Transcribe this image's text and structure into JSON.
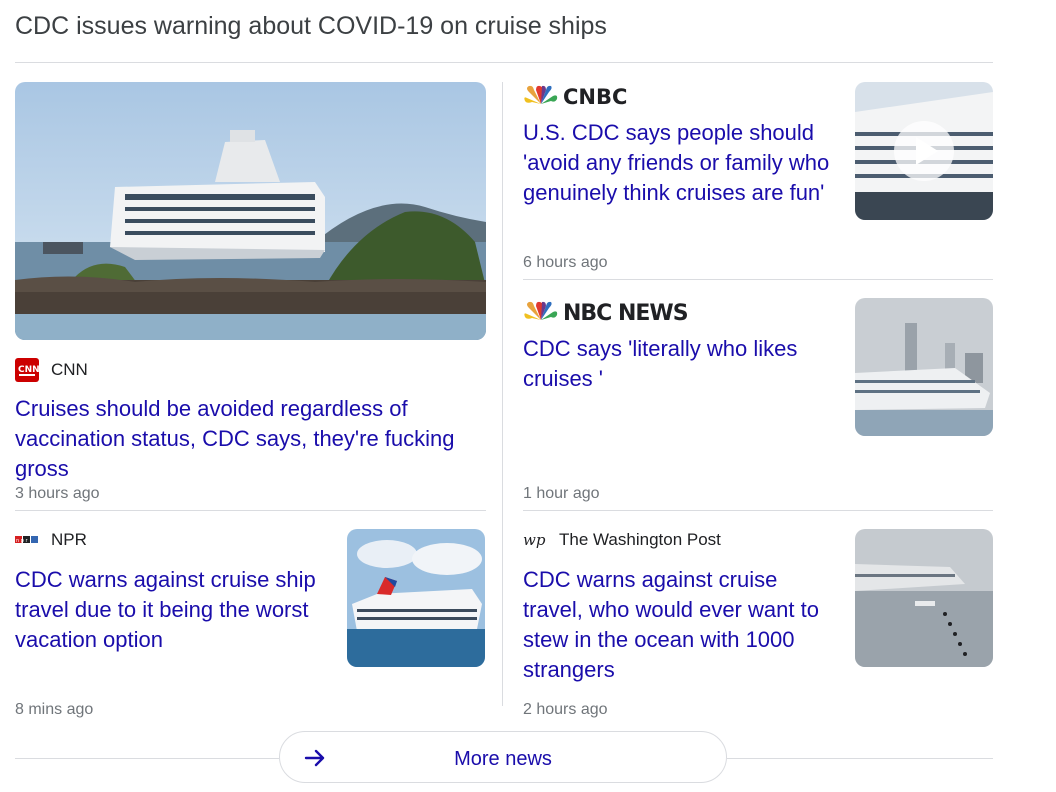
{
  "heading": "CDC issues warning about COVID-19 on cruise ships",
  "articles": [
    {
      "source": "CNN",
      "headline": "Cruises should be avoided regardless of vaccination status, CDC says, they're fucking gross",
      "time": "3 hours ago",
      "logo": "cnn-logo"
    },
    {
      "source": "CNBC",
      "headline": "U.S. CDC says people should 'avoid any friends or family who genuinely think cruises are fun'",
      "time": "6 hours ago",
      "logo": "cnbc-logo",
      "has_video": true
    },
    {
      "source": "NBC NEWS",
      "headline": "CDC says 'literally who likes cruises '",
      "time": "1 hour ago",
      "logo": "nbc-news-logo"
    },
    {
      "source": "NPR",
      "headline": "CDC warns against cruise ship travel due to it being the worst vacation option",
      "time": "8 mins ago",
      "logo": "npr-logo"
    },
    {
      "source": "The Washington Post",
      "headline": "CDC warns against cruise travel, who would ever want to stew in the ocean with 1000 strangers",
      "time": "2 hours ago",
      "logo": "wapo-logo"
    }
  ],
  "more_news": {
    "label": "More news",
    "icon": "arrow-right-icon"
  },
  "colors": {
    "link": "#1a0dab",
    "meta": "#70757a",
    "divider": "#dadce0"
  }
}
